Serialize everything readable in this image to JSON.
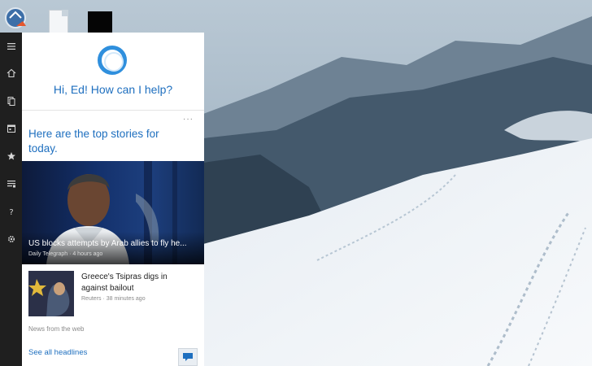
{
  "desktop": {
    "icons": [
      {
        "name": "recycle-bin-icon"
      },
      {
        "name": "document-file-icon"
      },
      {
        "name": "black-app-icon"
      }
    ]
  },
  "rail": {
    "items": [
      {
        "icon": "hamburger-menu-icon"
      },
      {
        "icon": "home-icon"
      },
      {
        "icon": "notebook-icon"
      },
      {
        "icon": "calendar-icon"
      },
      {
        "icon": "star-icon"
      },
      {
        "icon": "news-list-icon"
      },
      {
        "icon": "help-icon"
      },
      {
        "icon": "gear-icon"
      }
    ]
  },
  "cortana": {
    "greeting": "Hi, Ed! How can I help?",
    "stories_heading": "Here are the top stories for today.",
    "more_icon": "more-dots-icon",
    "hero": {
      "title": "US blocks attempts by Arab allies to fly he...",
      "source": "Daily Telegraph · 4 hours ago"
    },
    "story2": {
      "title": "Greece's Tsipras digs in against bailout",
      "source": "Reuters · 38 minutes ago"
    },
    "news_from_web": "News from the web",
    "see_all": "See all headlines",
    "feedback_icon": "feedback-icon"
  },
  "colors": {
    "accent": "#1e6fbf",
    "ring": "#2f8fdd",
    "rail_bg": "#1f1f1f"
  }
}
